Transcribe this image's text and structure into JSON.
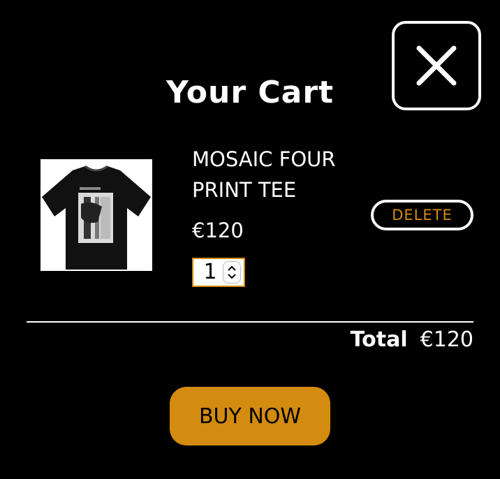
{
  "cart": {
    "title": "Your Cart",
    "close_icon": "close-x-icon",
    "items": [
      {
        "name": "MOSAIC FOUR PRINT TEE",
        "price": "€120",
        "quantity": "1",
        "image_icon": "black-graphic-tshirt",
        "delete_label": "DELETE"
      }
    ],
    "total_label": "Total",
    "total_value": "€120",
    "buy_label": "BUY NOW"
  },
  "colors": {
    "background": "#000000",
    "text": "#ffffff",
    "accent": "#d38c0f"
  }
}
